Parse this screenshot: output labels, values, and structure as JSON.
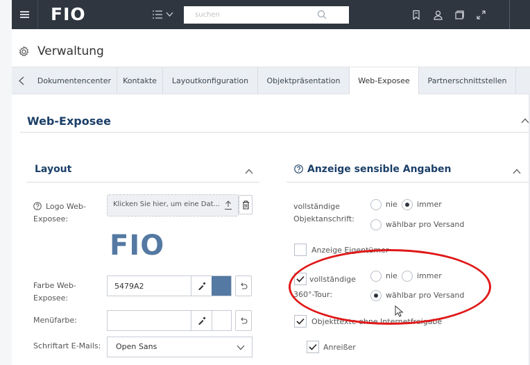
{
  "topbar": {
    "logo": "FIO",
    "search_placeholder": "suchen",
    "icons": [
      "bookmark-icon",
      "user-icon",
      "window-icon",
      "expand-icon"
    ]
  },
  "admin": {
    "title": "Verwaltung"
  },
  "tabs": [
    {
      "label": "Dokumentencenter",
      "active": false
    },
    {
      "label": "Kontakte",
      "active": false
    },
    {
      "label": "Layoutkonfiguration",
      "active": false
    },
    {
      "label": "Objektpräsentation",
      "active": false
    },
    {
      "label": "Web-Exposee",
      "active": true
    },
    {
      "label": "Partnerschnittstellen",
      "active": false
    }
  ],
  "section": {
    "title": "Web-Exposee"
  },
  "layout_card": {
    "title": "Layout",
    "logo_label": "Logo Web-Exposee:",
    "upload_text": "Klicken Sie hier, um eine Dat...",
    "logo_preview": "FIO",
    "color_label": "Farbe Web-Exposee:",
    "color_value": "5479A2",
    "color_hex": "#5479a2",
    "menu_color_label": "Menüfarbe:",
    "menu_color_value": "",
    "font_label": "Schriftart E-Mails:",
    "font_value": "Open Sans"
  },
  "sensitive_card": {
    "title": "Anzeige sensible Angaben",
    "address_label": "vollständige Objektanschrift:",
    "opt_never": "nie",
    "opt_always": "immer",
    "opt_per_dispatch": "wählbar pro Versand",
    "owner_label": "Anzeige Eigentümer",
    "tour_label_1": "vollständige",
    "tour_label_2": "360°-Tour:",
    "objtext_label": "Objekttexte ohne Internetfreigabe",
    "teaser_label": "Anreißer"
  },
  "colors": {
    "topbar": "#2f3640",
    "heading": "#1b3f68",
    "annotation": "#e01818"
  }
}
